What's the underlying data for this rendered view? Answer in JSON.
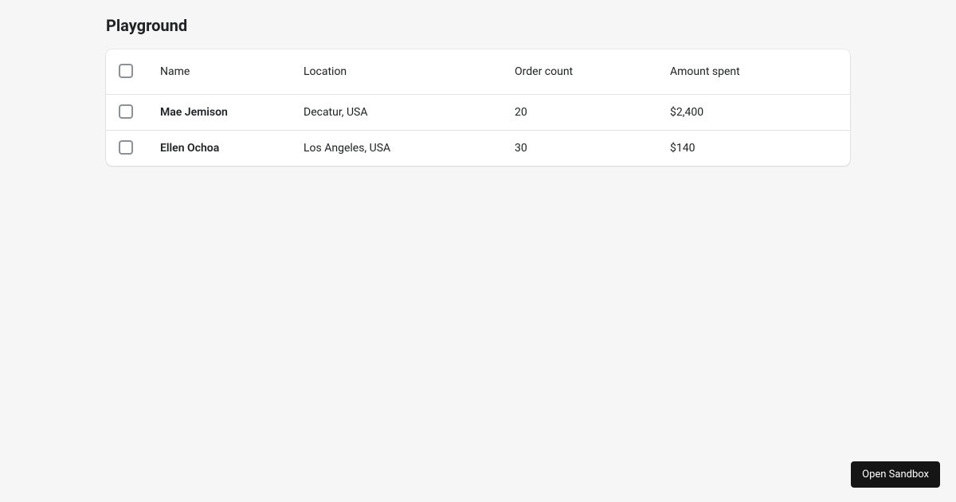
{
  "page": {
    "title": "Playground"
  },
  "table": {
    "headers": {
      "name": "Name",
      "location": "Location",
      "orders": "Order count",
      "amount": "Amount spent"
    },
    "rows": [
      {
        "name": "Mae Jemison",
        "location": "Decatur, USA",
        "orders": "20",
        "amount": "$2,400"
      },
      {
        "name": "Ellen Ochoa",
        "location": "Los Angeles, USA",
        "orders": "30",
        "amount": "$140"
      }
    ]
  },
  "sandbox": {
    "label": "Open Sandbox"
  }
}
